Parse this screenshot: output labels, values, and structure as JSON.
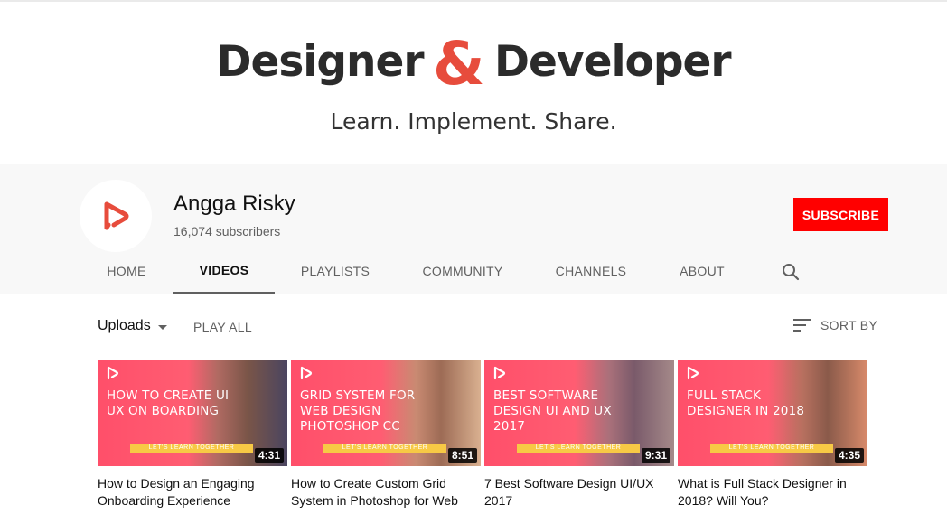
{
  "banner": {
    "word_left": "Designer",
    "ampersand": "&",
    "word_right": "Developer",
    "tagline": "Learn. Implement. Share."
  },
  "channel": {
    "name": "Angga Risky",
    "subscribers": "16,074 subscribers",
    "subscribe_label": "SUBSCRIBE"
  },
  "tabs": [
    "HOME",
    "VIDEOS",
    "PLAYLISTS",
    "COMMUNITY",
    "CHANNELS",
    "ABOUT"
  ],
  "active_tab": "VIDEOS",
  "toolbar": {
    "uploads_label": "Uploads",
    "play_all": "PLAY ALL",
    "sort_by": "SORT BY"
  },
  "videos": [
    {
      "thumb_text": "HOW TO CREATE UI UX ON BOARDING",
      "band": "LET'S LEARN TOGETHER",
      "duration": "4:31",
      "title": "How to Design an Engaging Onboarding Experience"
    },
    {
      "thumb_text": "GRID SYSTEM FOR WEB DESIGN PHOTOSHOP CC",
      "band": "LET'S LEARN TOGETHER",
      "duration": "8:51",
      "title": "How to Create Custom Grid System in Photoshop for Web"
    },
    {
      "thumb_text": "BEST SOFTWARE DESIGN UI AND UX 2017",
      "band": "LET'S LEARN TOGETHER",
      "duration": "9:31",
      "title": "7 Best Software Design UI/UX 2017"
    },
    {
      "thumb_text": "FULL STACK DESIGNER IN 2018",
      "band": "LET'S LEARN TOGETHER",
      "duration": "4:35",
      "title": "What is Full Stack Designer in 2018? Will You?"
    }
  ],
  "colors": {
    "accent_red": "#ff0000",
    "brand_coral": "#e74c3c",
    "thumb_pink": "#ff5a6e",
    "band_yellow": "#f7c945"
  },
  "icons": {
    "channel_logo": "play-logo-icon",
    "search": "search-icon",
    "sort": "sort-icon",
    "dropdown": "caret-down-icon"
  }
}
